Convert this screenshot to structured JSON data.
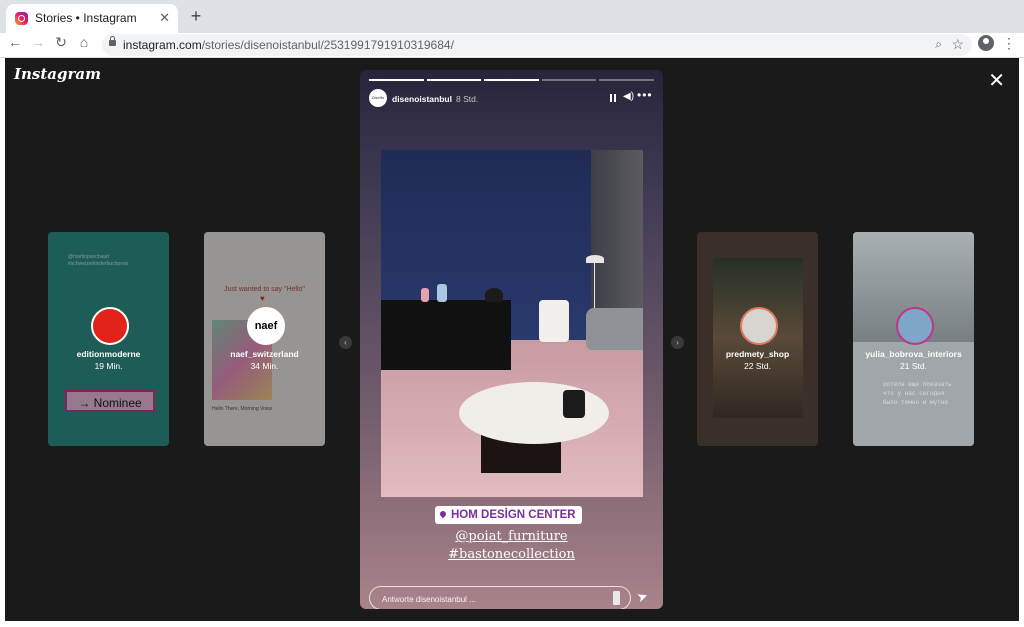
{
  "browser": {
    "tab_title": "Stories • Instagram",
    "tab_close": "✕",
    "new_tab": "+",
    "url_domain": "instagram.com",
    "url_path": "/stories/disenoistanbul/2531991791910319684/",
    "back": "←",
    "forward": "→",
    "reload": "↻",
    "home": "⌂",
    "zoom_icon": "⌕",
    "star": "☆",
    "menu": "⋮"
  },
  "viewer": {
    "logo": "Instagram",
    "close": "✕"
  },
  "previews": [
    {
      "username": "editionmoderne",
      "time": "19 Min.",
      "top_text_1": "@martinpanchaud",
      "top_text_2": "#schweizerkinderbuchpreis",
      "badge": "→ Nominee"
    },
    {
      "username": "naef_switzerland",
      "time": "34 Min.",
      "hello": "Just wanted to say \"Hello\"",
      "heart": "♥",
      "song": "Hello There, Morning Voice",
      "avatar_text": "naef"
    },
    {
      "username": "predmety_shop",
      "time": "22 Std."
    },
    {
      "username": "yulia_bobrova_interiors",
      "time": "21 Std.",
      "caption_1": "хотела еще показать",
      "caption_2": "что у нас сегодня",
      "caption_3": "было темно и мутно"
    }
  ],
  "arrows": {
    "prev": "‹",
    "next": "›"
  },
  "story": {
    "username": "disenoistanbul",
    "time": "8 Std.",
    "avatar_text": "Diseño",
    "more": "•••",
    "mute": "🔇",
    "progress": [
      1,
      1,
      1,
      0,
      0
    ],
    "location": "HOM DESİGN CENTER",
    "mention": "@poiat_furniture",
    "hashtag": "#bastonecollection",
    "reply_placeholder": "Antworte disenoistanbul ...",
    "send": "➤"
  }
}
